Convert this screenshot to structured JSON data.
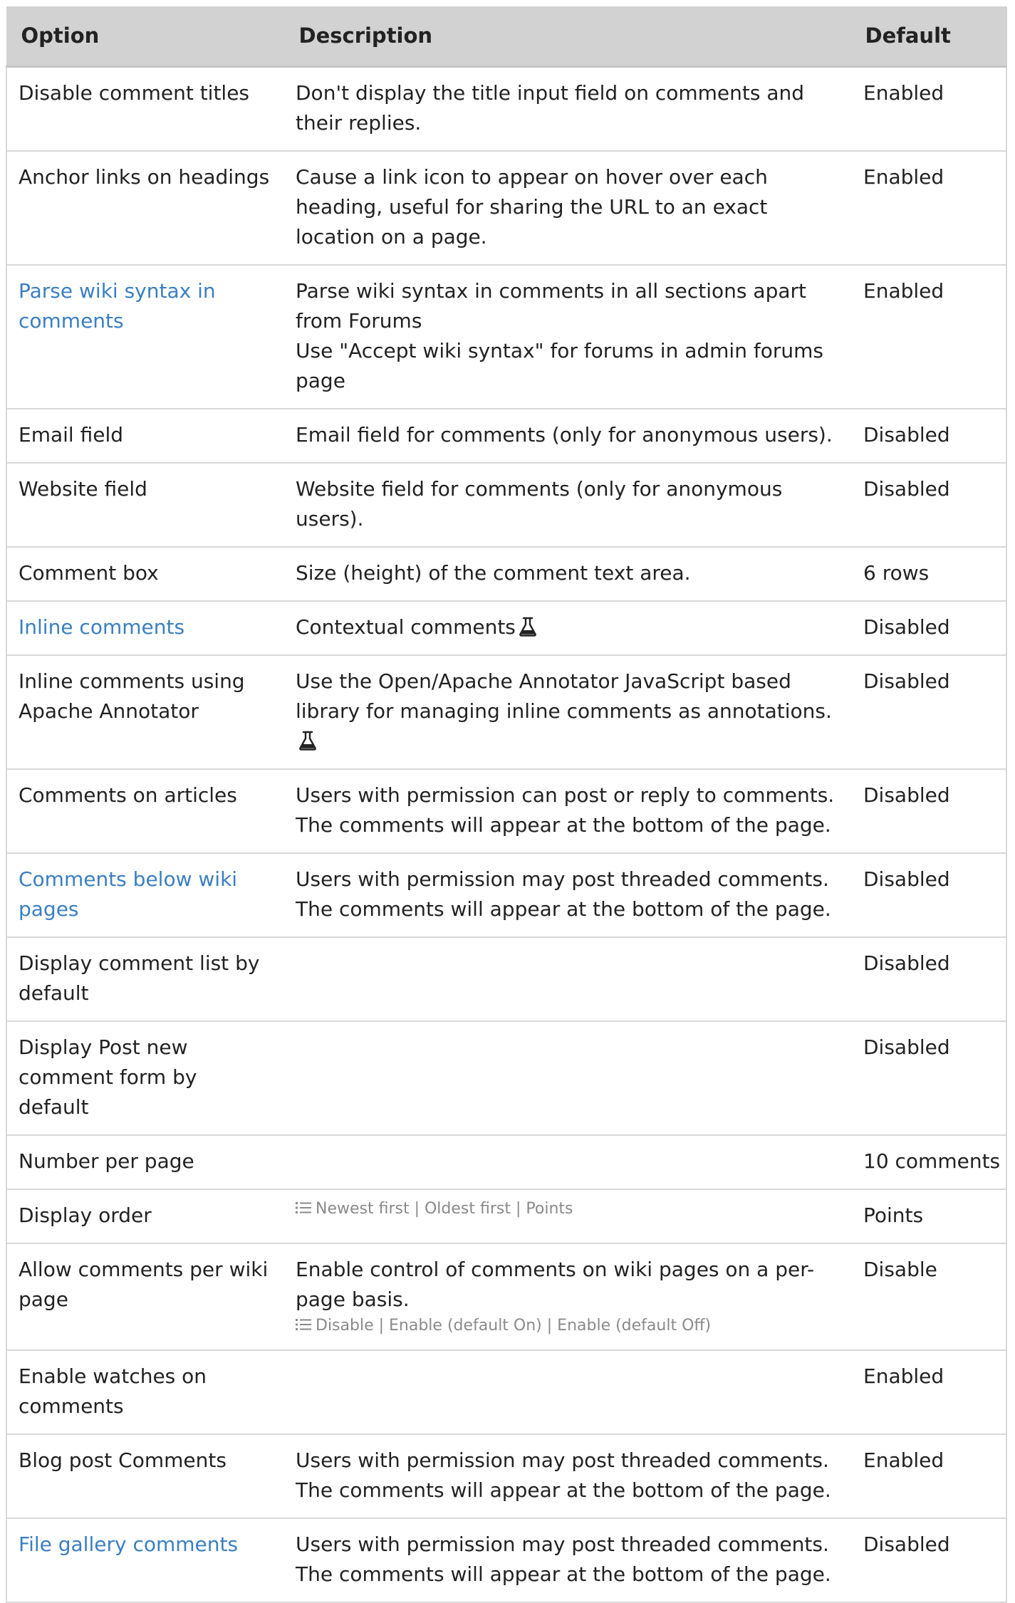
{
  "table": {
    "headers": {
      "option": "Option",
      "description": "Description",
      "default": "Default"
    },
    "rows": [
      {
        "option": "Disable comment titles",
        "option_is_link": false,
        "description": [
          "Don't display the title input field on comments and their replies."
        ],
        "experimental": false,
        "choices": "",
        "default": "Enabled"
      },
      {
        "option": "Anchor links on headings",
        "option_is_link": false,
        "description": [
          "Cause a link icon to appear on hover over each heading, useful for sharing the URL to an exact location on a page."
        ],
        "experimental": false,
        "choices": "",
        "default": "Enabled"
      },
      {
        "option": "Parse wiki syntax in comments",
        "option_is_link": true,
        "description": [
          "Parse wiki syntax in comments in all sections apart from Forums",
          "Use \"Accept wiki syntax\" for forums in admin forums page"
        ],
        "experimental": false,
        "choices": "",
        "default": "Enabled"
      },
      {
        "option": "Email field",
        "option_is_link": false,
        "description": [
          "Email field for comments (only for anonymous users)."
        ],
        "experimental": false,
        "choices": "",
        "default": "Disabled"
      },
      {
        "option": "Website field",
        "option_is_link": false,
        "description": [
          "Website field for comments (only for anonymous users)."
        ],
        "experimental": false,
        "choices": "",
        "default": "Disabled"
      },
      {
        "option": "Comment box",
        "option_is_link": false,
        "description": [
          "Size (height) of the comment text area."
        ],
        "experimental": false,
        "choices": "",
        "default": "6 rows"
      },
      {
        "option": "Inline comments",
        "option_is_link": true,
        "description": [
          "Contextual comments"
        ],
        "experimental": true,
        "choices": "",
        "default": "Disabled"
      },
      {
        "option": "Inline comments using Apache Annotator",
        "option_is_link": false,
        "description": [
          "Use the Open/Apache Annotator JavaScript based library for managing inline comments as annotations."
        ],
        "experimental": true,
        "choices": "",
        "default": "Disabled"
      },
      {
        "option": "Comments on articles",
        "option_is_link": false,
        "description": [
          "Users with permission can post or reply to comments. The comments will appear at the bottom of the page."
        ],
        "experimental": false,
        "choices": "",
        "default": "Disabled"
      },
      {
        "option": "Comments below wiki pages",
        "option_is_link": true,
        "description": [
          "Users with permission may post threaded comments. The comments will appear at the bottom of the page."
        ],
        "experimental": false,
        "choices": "",
        "default": "Disabled"
      },
      {
        "option": "Display comment list by default",
        "option_is_link": false,
        "description": [],
        "experimental": false,
        "choices": "",
        "default": "Disabled"
      },
      {
        "option": "Display Post new comment form by default",
        "option_is_link": false,
        "description": [],
        "experimental": false,
        "choices": "",
        "default": "Disabled"
      },
      {
        "option": "Number per page",
        "option_is_link": false,
        "description": [],
        "experimental": false,
        "choices": "",
        "default": "10 comments"
      },
      {
        "option": "Display order",
        "option_is_link": false,
        "description": [],
        "experimental": false,
        "choices": "Newest first | Oldest first | Points",
        "default": "Points"
      },
      {
        "option": "Allow comments per wiki page",
        "option_is_link": false,
        "description": [
          "Enable control of comments on wiki pages on a per-page basis."
        ],
        "experimental": false,
        "choices": "Disable | Enable (default On) | Enable (default Off)",
        "default": "Disable"
      },
      {
        "option": "Enable watches on comments",
        "option_is_link": false,
        "description": [],
        "experimental": false,
        "choices": "",
        "default": "Enabled"
      },
      {
        "option": "Blog post Comments",
        "option_is_link": false,
        "description": [
          "Users with permission may post threaded comments. The comments will appear at the bottom of the page."
        ],
        "experimental": false,
        "choices": "",
        "default": "Enabled"
      },
      {
        "option": "File gallery comments",
        "option_is_link": true,
        "description": [
          "Users with permission may post threaded comments. The comments will appear at the bottom of the page."
        ],
        "experimental": false,
        "choices": "",
        "default": "Disabled"
      }
    ]
  },
  "icons": {
    "experimental": "flask-icon",
    "choices": "list-icon"
  },
  "colors": {
    "header_bg": "#d2d2d2",
    "link": "#3a7fc1",
    "muted": "#8a8a8a",
    "border": "#d8d8d8"
  }
}
